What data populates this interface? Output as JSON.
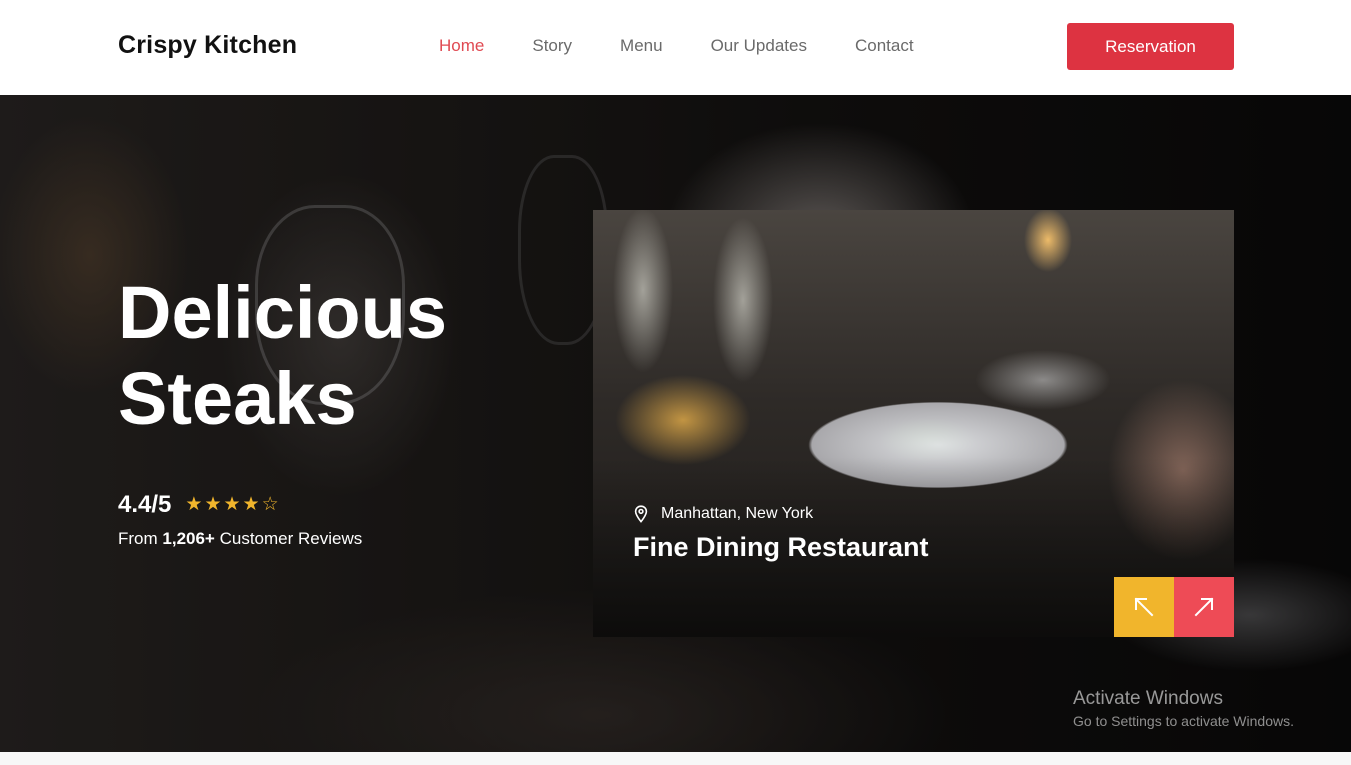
{
  "header": {
    "brand": "Crispy Kitchen",
    "nav": [
      {
        "label": "Home",
        "active": true
      },
      {
        "label": "Story",
        "active": false
      },
      {
        "label": "Menu",
        "active": false
      },
      {
        "label": "Our Updates",
        "active": false
      },
      {
        "label": "Contact",
        "active": false
      }
    ],
    "reservation_label": "Reservation"
  },
  "hero": {
    "title_line1": "Delicious",
    "title_line2": "Steaks",
    "rating": "4.4/5",
    "stars": {
      "filled": 4,
      "total": 5
    },
    "reviews_prefix": "From ",
    "reviews_count": "1,206+",
    "reviews_suffix": " Customer Reviews"
  },
  "card": {
    "location": "Manhattan, New York",
    "title": "Fine Dining Restaurant",
    "prev_icon": "arrow-up-left-icon",
    "next_icon": "arrow-up-right-icon"
  },
  "watermark": {
    "title": "Activate Windows",
    "subtitle": "Go to Settings to activate Windows."
  },
  "colors": {
    "accent_red": "#dd3341",
    "active_nav": "#e04a52",
    "star_yellow": "#f1b52c",
    "arrow_prev_bg": "#f1b52c",
    "arrow_next_bg": "#ee4b56"
  }
}
